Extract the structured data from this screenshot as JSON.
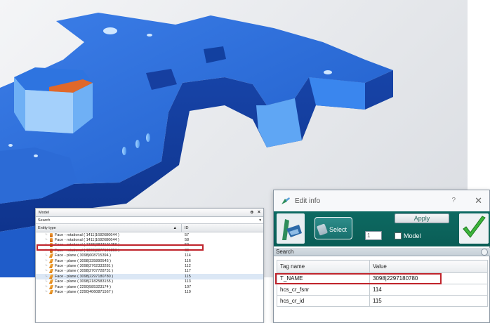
{
  "model_panel": {
    "title": "Model",
    "search_label": "Search",
    "columns": [
      "Entity type",
      "ID"
    ],
    "rows": [
      {
        "label": "Face - rotational ( 1411|1682680644 )",
        "id": "57",
        "icon": "rotational-face-icon"
      },
      {
        "label": "Face - rotational ( 1411|1682680644 )",
        "id": "58",
        "icon": "rotational-face-icon"
      },
      {
        "label": "Face - rotational ( 1338|3877191259 )",
        "id": "59",
        "icon": "rotational-face-icon"
      },
      {
        "label": "Face - rotational ( 1338|3877191259 )",
        "id": "60",
        "icon": "rotational-face-icon"
      },
      {
        "label": "Face - plane ( 3098|608715394 )",
        "id": "114",
        "icon": "plane-face-icon"
      },
      {
        "label": "Face - plane ( 3098|335890545 )",
        "id": "116",
        "icon": "plane-face-icon"
      },
      {
        "label": "Face - plane ( 3098|2762333281 )",
        "id": "112",
        "icon": "plane-face-icon"
      },
      {
        "label": "Face - plane ( 3098|2707728731 )",
        "id": "117",
        "icon": "plane-face-icon"
      },
      {
        "label": "Face - plane ( 3098|2297180780 )",
        "id": "115",
        "icon": "plane-face-icon",
        "selected": true
      },
      {
        "label": "Face - plane ( 3098|2182583155 )",
        "id": "113",
        "icon": "plane-face-icon"
      },
      {
        "label": "Face - plane ( 2290|585323174 )",
        "id": "107",
        "icon": "plane-face-icon"
      },
      {
        "label": "Face - plane ( 2290|4060871567 )",
        "id": "110",
        "icon": "plane-face-icon"
      }
    ]
  },
  "edit_dialog": {
    "title": "Edit info",
    "help_label": "?",
    "close_label": "✕",
    "select_label": "Select",
    "count_value": "1",
    "apply_label": "Apply",
    "model_label": "Model",
    "search_label": "Search",
    "columns": {
      "tag": "Tag name",
      "value": "Value"
    },
    "rows": [
      {
        "tag": "T_NAME",
        "value": "3098|2297180780"
      },
      {
        "tag": "hcs_cr_fsnr",
        "value": "114"
      },
      {
        "tag": "hcs_cr_id",
        "value": "115"
      }
    ]
  },
  "colors": {
    "part_blue": "#2f6fdc",
    "highlight_face": "#e0682a",
    "toolbar_teal": "#0b6259",
    "highlight_red": "#c0232b"
  }
}
